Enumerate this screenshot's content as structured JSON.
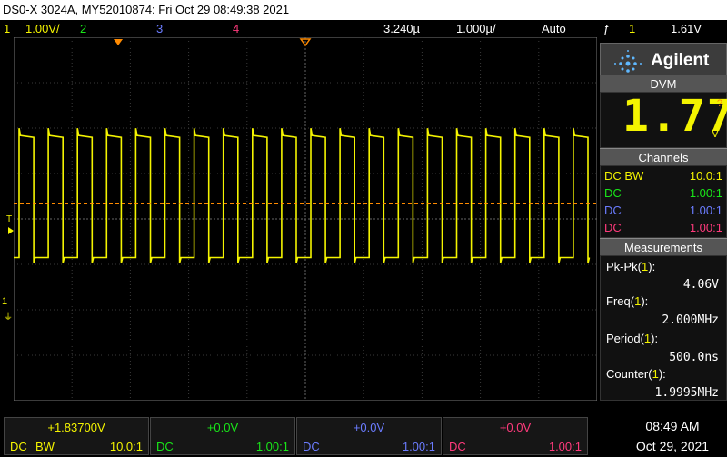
{
  "title": "DS0-X 3024A, MY52010874: Fri Oct 29 08:49:38 2021",
  "top": {
    "ch1_num": "1",
    "ch1_scale": "1.00V/",
    "ch2_num": "2",
    "ch3_num": "3",
    "ch4_num": "4",
    "delay": "3.240µ",
    "timebase": "1.000µ/",
    "mode": "Auto",
    "trig_icon": "ƒ",
    "trig_ch": "1",
    "trig_level": "1.61V"
  },
  "brand": "Agilent",
  "dvm": {
    "header": "DVM",
    "reading": "1.77",
    "unit": "V",
    "flag": "?"
  },
  "channels": {
    "header": "Channels",
    "rows": [
      {
        "coupling": "DC BW",
        "probe": "10.0:1",
        "color": "#f4f400"
      },
      {
        "coupling": "DC",
        "probe": "1.00:1",
        "color": "#19e619"
      },
      {
        "coupling": "DC",
        "probe": "1.00:1",
        "color": "#6b7cff"
      },
      {
        "coupling": "DC",
        "probe": "1.00:1",
        "color": "#ff3a7c"
      }
    ]
  },
  "measurements": {
    "header": "Measurements",
    "items": [
      {
        "label": "Pk-Pk",
        "ch": "1",
        "value": "4.06V"
      },
      {
        "label": "Freq",
        "ch": "1",
        "value": "2.000MHz"
      },
      {
        "label": "Period",
        "ch": "1",
        "value": "500.0ns"
      },
      {
        "label": "Counter",
        "ch": "1",
        "value": "1.9995MHz"
      }
    ]
  },
  "markers": {
    "trigger": "T",
    "ch1_ground": "1"
  },
  "bottom": {
    "ch1": {
      "offset": "+1.83700V",
      "coupling": "DC",
      "bw": "BW",
      "probe": "10.0:1"
    },
    "ch2": {
      "offset": "+0.0V",
      "coupling": "DC",
      "probe": "1.00:1"
    },
    "ch3": {
      "offset": "+0.0V",
      "coupling": "DC",
      "probe": "1.00:1"
    },
    "ch4": {
      "offset": "+0.0V",
      "coupling": "DC",
      "probe": "1.00:1"
    },
    "time": "08:49 AM",
    "date": "Oct 29, 2021"
  },
  "waveform": {
    "period_us": 0.5,
    "high_v": 1.837,
    "low_v": -0.85,
    "trigger_level_v": 0.35,
    "volts_per_div": 1.0,
    "us_per_div": 1.0
  },
  "colors": {
    "ch1": "#f4f400",
    "ch2": "#19e619",
    "ch3": "#6b7cff",
    "ch4": "#ff3a7c",
    "trigger": "#ff8a00"
  }
}
